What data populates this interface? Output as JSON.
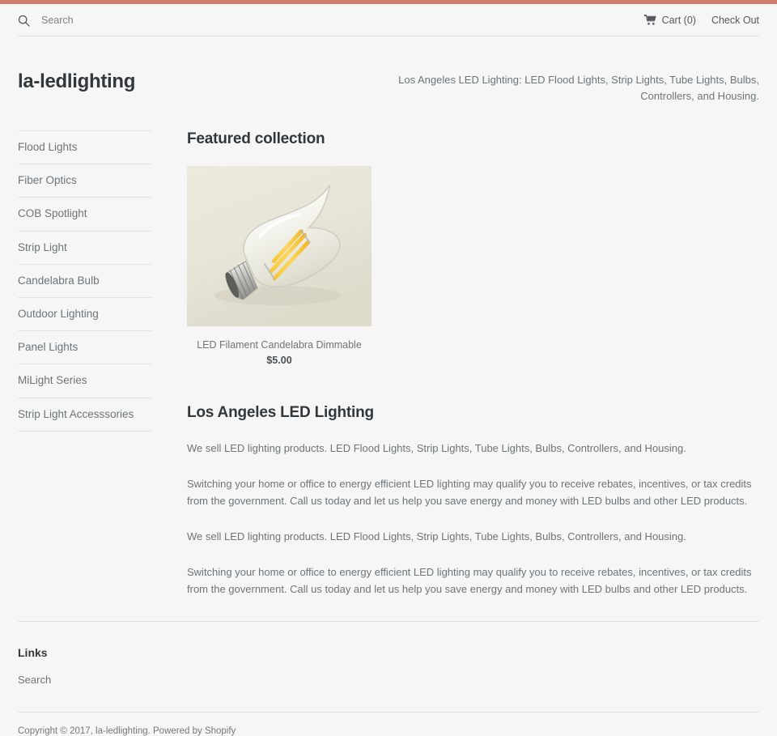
{
  "accent_color": "#d4796e",
  "utility_bar": {
    "search_icon": "search-icon",
    "search_placeholder": "Search",
    "search_value": "",
    "cart_icon": "shopping-cart-icon",
    "cart_label": "Cart (0)",
    "checkout_label": "Check Out"
  },
  "header": {
    "site_title": "la-ledlighting",
    "tagline": "Los Angeles LED Lighting: LED Flood Lights, Strip Lights, Tube Lights, Bulbs, Controllers, and Housing."
  },
  "sidebar": {
    "items": [
      {
        "label": "Flood Lights"
      },
      {
        "label": "Fiber Optics"
      },
      {
        "label": "COB Spotlight"
      },
      {
        "label": "Strip Light"
      },
      {
        "label": "Candelabra Bulb"
      },
      {
        "label": "Outdoor Lighting"
      },
      {
        "label": "Panel Lights"
      },
      {
        "label": "MiLight Series"
      },
      {
        "label": "Strip Light Accesssories"
      }
    ]
  },
  "featured": {
    "title": "Featured collection",
    "products": [
      {
        "image_alt": "led-filament-candelabra-bulb-photo",
        "title": "LED Filament Candelabra Dimmable",
        "price": "$5.00"
      }
    ]
  },
  "rich_text": {
    "heading": "Los Angeles LED Lighting",
    "paragraphs": [
      "We sell LED lighting products. LED Flood Lights, Strip Lights, Tube Lights, Bulbs, Controllers, and Housing.",
      "Switching your home or office to energy efficient LED lighting may qualify you to receive rebates, incentives, or tax credits from the government. Call us today and let us help you save energy and money with LED bulbs and other LED products.",
      "We sell LED lighting products. LED Flood Lights, Strip Lights, Tube Lights, Bulbs, Controllers, and Housing.",
      "Switching your home or office to energy efficient LED lighting may qualify you to receive rebates, incentives, or tax credits from the government. Call us today and let us help you save energy and money with LED bulbs and other LED products."
    ]
  },
  "footer": {
    "heading": "Links",
    "links": [
      {
        "label": "Search"
      }
    ],
    "copyright": "Copyright © 2017, la-ledlighting. Powered by Shopify"
  }
}
